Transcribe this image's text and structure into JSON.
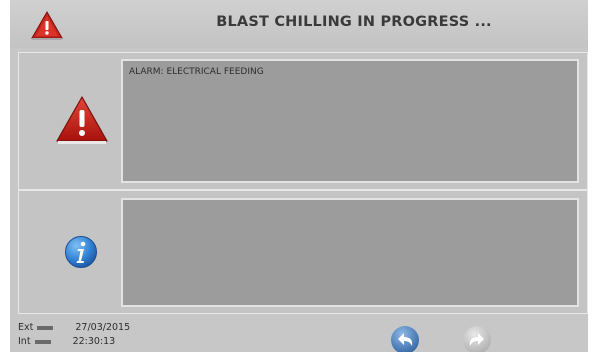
{
  "header": {
    "title": "BLAST CHILLING IN PROGRESS ..."
  },
  "alarm": {
    "message": "ALARM: ELECTRICAL FEEDING"
  },
  "info": {
    "message": ""
  },
  "footer": {
    "ext_label": "Ext",
    "int_label": "Int",
    "date": "27/03/2015",
    "time": "22:30:13"
  },
  "colors": {
    "background": "#c7c7c7",
    "panel_box": "#9c9c9c",
    "warning_red": "#c8231b",
    "info_blue": "#2f7fd2"
  },
  "icons": [
    "warning-icon",
    "info-icon",
    "back-icon",
    "forward-icon"
  ]
}
